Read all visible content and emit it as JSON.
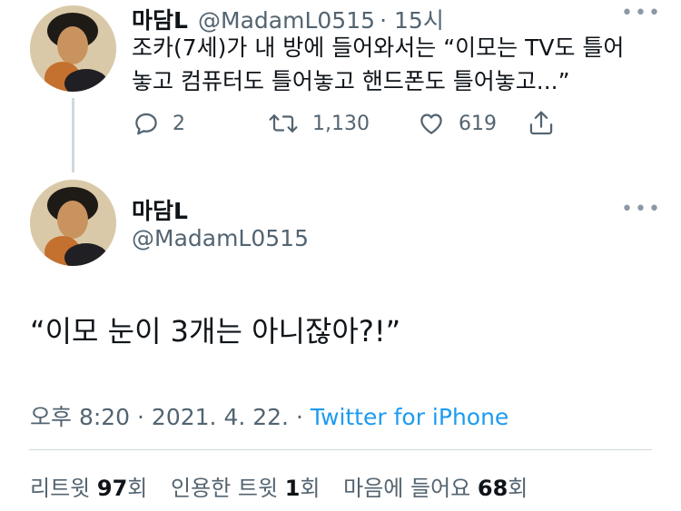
{
  "tweet1": {
    "name": "마담L",
    "handle": "@MadamL0515",
    "time": "· 15시",
    "text_line1": "조카(7세)가 내 방에 들어와서는 “이모는 TV도 틀어",
    "text_line2": "놓고 컴퓨터도 틀어놓고 핸드폰도 틀어놓고...”",
    "reply_count": "2",
    "retweet_count": "1,130",
    "like_count": "619"
  },
  "tweet2": {
    "name": "마담L",
    "handle": "@MadamL0515",
    "text": "“이모 눈이 3개는 아니잖아?!”",
    "timestamp": "오후 8:20 · 2021. 4. 22. ·",
    "source": "Twitter for iPhone",
    "stats": {
      "retweets_label": "리트윗",
      "retweets": "97",
      "retweets_unit": "회",
      "quotes_label": "인용한 트윗",
      "quotes": "1",
      "quotes_unit": "회",
      "likes_label": "마음에 들어요",
      "likes": "68",
      "likes_unit": "회"
    }
  },
  "icons": [
    "reply-icon",
    "retweet-icon",
    "like-icon",
    "share-icon",
    "more-icon"
  ],
  "colors": {
    "link": "#1d9bf0",
    "secondary": "#536471",
    "divider": "#cfd9de"
  }
}
